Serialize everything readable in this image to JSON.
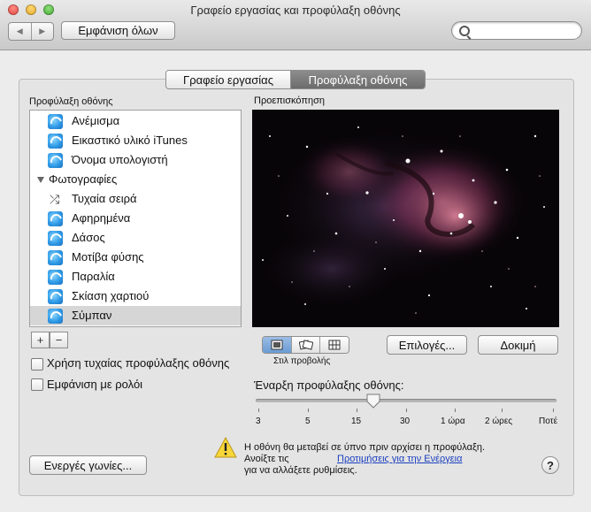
{
  "window": {
    "title": "Γραφείο εργασίας και προφύλαξη οθόνης"
  },
  "toolbar": {
    "back_glyph": "◀",
    "forward_glyph": "▶",
    "show_all_label": "Εμφάνιση όλων",
    "search_placeholder": ""
  },
  "tabs": [
    {
      "label": "Γραφείο εργασίας"
    },
    {
      "label": "Προφύλαξη οθόνης"
    }
  ],
  "screensaver_list": {
    "header": "Προφύλαξη οθόνης",
    "items": [
      {
        "label": "Ανέμισμα",
        "icon": "screensaver-icon"
      },
      {
        "label": "Εικαστικό υλικό iTunes",
        "icon": "screensaver-icon"
      },
      {
        "label": "Όνομα υπολογιστή",
        "icon": "screensaver-icon"
      }
    ],
    "group": {
      "label": "Φωτογραφίες",
      "expanded": true
    },
    "group_items": [
      {
        "label": "Τυχαία σειρά",
        "icon": "shuffle-icon"
      },
      {
        "label": "Αφηρημένα",
        "icon": "screensaver-icon"
      },
      {
        "label": "Δάσος",
        "icon": "screensaver-icon"
      },
      {
        "label": "Μοτίβα φύσης",
        "icon": "screensaver-icon"
      },
      {
        "label": "Παραλία",
        "icon": "screensaver-icon"
      },
      {
        "label": "Σκίαση χαρτιού",
        "icon": "screensaver-icon"
      },
      {
        "label": "Σύμπαν",
        "icon": "screensaver-icon",
        "selected": true
      }
    ],
    "add_label": "+",
    "remove_label": "−"
  },
  "preview": {
    "header": "Προεπισκόπηση"
  },
  "display_style": {
    "label": "Στιλ προβολής",
    "selected": 0
  },
  "buttons": {
    "options": "Επιλογές...",
    "test": "Δοκιμή",
    "hot_corners": "Ενεργές γωνίες..."
  },
  "checkboxes": {
    "random": {
      "label": "Χρήση τυχαίας προφύλαξης οθόνης",
      "checked": false
    },
    "clock": {
      "label": "Εμφάνιση με ρολόι",
      "checked": false
    }
  },
  "start_after": {
    "label": "Έναρξη προφύλαξης οθόνης:",
    "ticks": [
      "3",
      "5",
      "15",
      "30",
      "1 ώρα",
      "2 ώρες",
      "Ποτέ"
    ],
    "value": "15"
  },
  "warning": {
    "line1": "Η οθόνη θα μεταβεί σε ύπνο πριν αρχίσει η προφύλαξη.",
    "line2_prefix": "Ανοίξτε τις",
    "link": "Προτιμήσεις για την Ενέργεια",
    "line3": "για να αλλάξετε ρυθμίσεις."
  },
  "help_label": "?"
}
